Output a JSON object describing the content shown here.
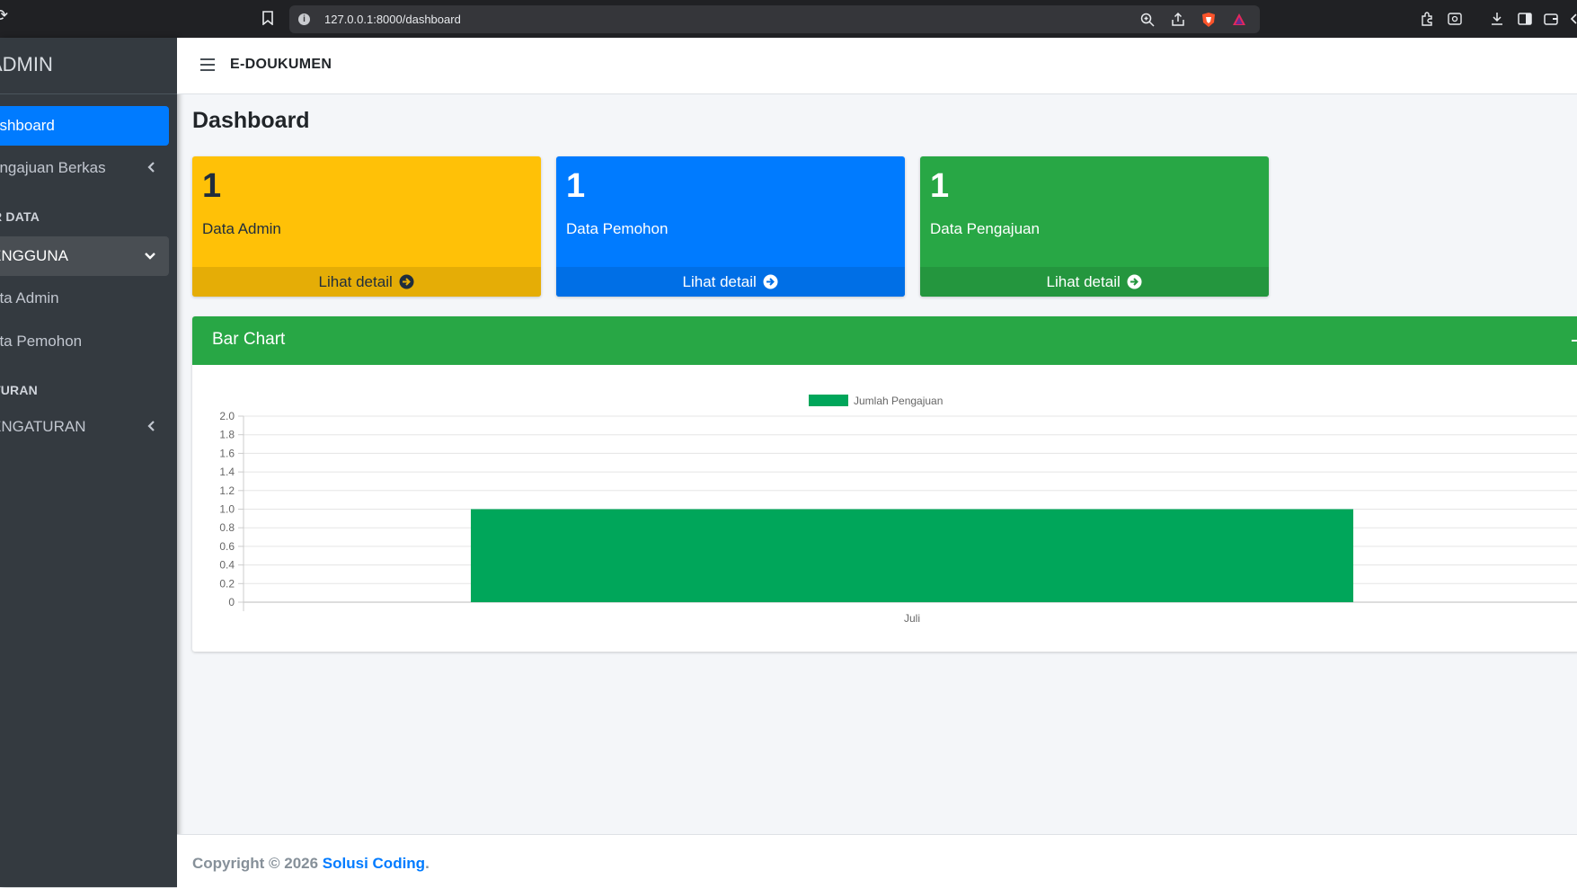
{
  "browser": {
    "url": "127.0.0.1:8000/dashboard"
  },
  "sidebar": {
    "brand": "ADMIN",
    "items": [
      {
        "label": "ashboard",
        "state": "active",
        "chevron": "none"
      },
      {
        "label": "engajuan Berkas",
        "state": "normal",
        "chevron": "left"
      },
      {
        "label": "ENGGUNA",
        "state": "open",
        "chevron": "down"
      },
      {
        "label": "ata Admin",
        "state": "normal",
        "chevron": "none"
      },
      {
        "label": "ata Pemohon",
        "state": "normal",
        "chevron": "none"
      },
      {
        "label": "ENGATURAN",
        "state": "normal",
        "chevron": "left"
      }
    ],
    "headers": [
      "R DATA",
      "TURAN"
    ]
  },
  "navbar": {
    "app_name": "E-DOUKUMEN"
  },
  "page": {
    "title": "Dashboard"
  },
  "stats": [
    {
      "value": "1",
      "label": "Data Admin",
      "link": "Lihat detail",
      "color": "#ffc107"
    },
    {
      "value": "1",
      "label": "Data Pemohon",
      "link": "Lihat detail",
      "color": "#007bff"
    },
    {
      "value": "1",
      "label": "Data Pengajuan",
      "link": "Lihat detail",
      "color": "#28a745"
    }
  ],
  "chart_card": {
    "title": "Bar Chart"
  },
  "chart_data": {
    "type": "bar",
    "categories": [
      "Juli"
    ],
    "series": [
      {
        "name": "Jumlah Pengajuan",
        "values": [
          1
        ],
        "color": "#00a65a"
      }
    ],
    "ylim": [
      0,
      2.0
    ],
    "yticks": [
      "2.0",
      "1.8",
      "1.6",
      "1.4",
      "1.2",
      "1.0",
      "0.8",
      "0.6",
      "0.4",
      "0.2",
      "0"
    ],
    "grid": true,
    "legend": "top-center"
  },
  "footer": {
    "copyright": "Copyright © 2026 ",
    "company": "Solusi Coding",
    "end": "."
  }
}
